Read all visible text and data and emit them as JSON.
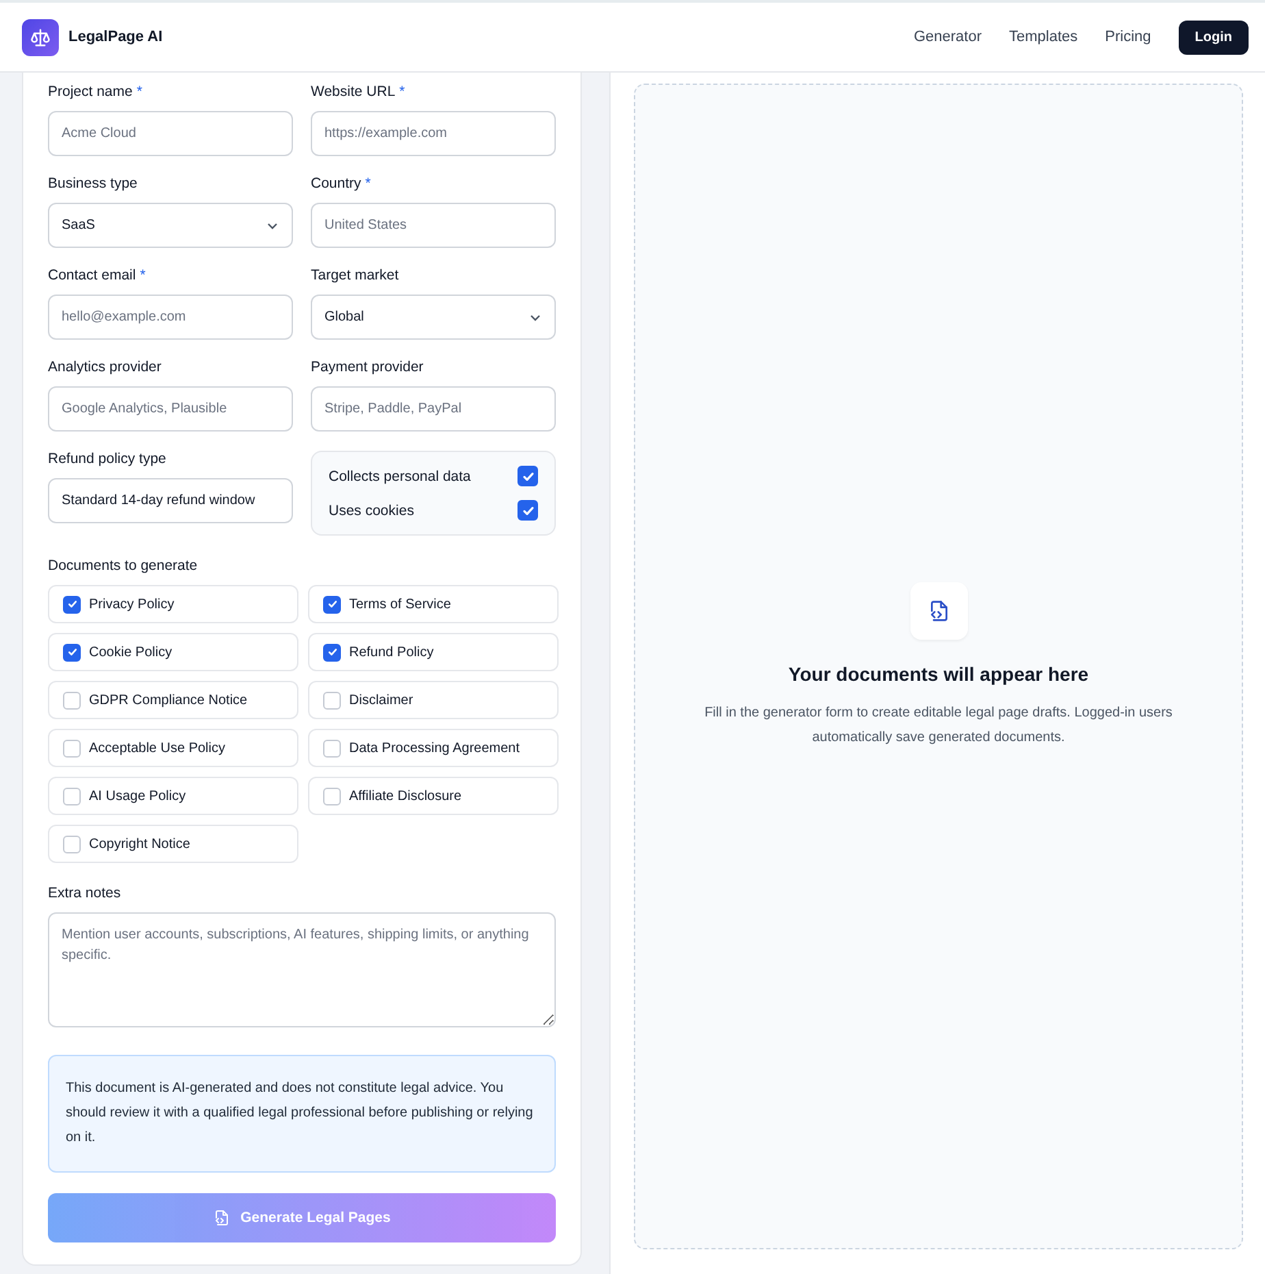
{
  "header": {
    "brand": "LegalPage AI",
    "nav": [
      {
        "label": "Generator"
      },
      {
        "label": "Templates"
      },
      {
        "label": "Pricing"
      }
    ],
    "login": "Login"
  },
  "form": {
    "fields": [
      {
        "kind": "input",
        "label": "Project name",
        "required_mark": "*",
        "placeholder": "Acme Cloud"
      },
      {
        "kind": "input",
        "label": "Website URL",
        "required_mark": "*",
        "placeholder": "https://example.com"
      },
      {
        "kind": "select",
        "label": "Business type",
        "value": "SaaS"
      },
      {
        "kind": "input",
        "label": "Country",
        "required_mark": "*",
        "placeholder": "United States"
      },
      {
        "kind": "input",
        "label": "Contact email",
        "required_mark": "*",
        "placeholder": "hello@example.com"
      },
      {
        "kind": "select",
        "label": "Target market",
        "value": "Global"
      },
      {
        "kind": "input",
        "label": "Analytics provider",
        "placeholder": "Google Analytics, Plausible"
      },
      {
        "kind": "input",
        "label": "Payment provider",
        "placeholder": "Stripe, Paddle, PayPal"
      },
      {
        "kind": "input",
        "label": "Refund policy type",
        "value": "Standard 14-day refund window"
      },
      {
        "kind": "toggles",
        "items": [
          {
            "label": "Collects personal data",
            "checked": true
          },
          {
            "label": "Uses cookies",
            "checked": true
          }
        ]
      }
    ],
    "documents": {
      "label": "Documents to generate",
      "items": [
        {
          "label": "Privacy Policy",
          "checked": true
        },
        {
          "label": "Terms of Service",
          "checked": true
        },
        {
          "label": "Cookie Policy",
          "checked": true
        },
        {
          "label": "Refund Policy",
          "checked": true
        },
        {
          "label": "GDPR Compliance Notice",
          "checked": false
        },
        {
          "label": "Disclaimer",
          "checked": false
        },
        {
          "label": "Acceptable Use Policy",
          "checked": false
        },
        {
          "label": "Data Processing Agreement",
          "checked": false
        },
        {
          "label": "AI Usage Policy",
          "checked": false
        },
        {
          "label": "Affiliate Disclosure",
          "checked": false
        },
        {
          "label": "Copyright Notice",
          "checked": false
        }
      ]
    },
    "notes": {
      "label": "Extra notes",
      "placeholder": "Mention user accounts, subscriptions, AI features, shipping limits, or anything specific."
    },
    "disclaimer": "This document is AI-generated and does not constitute legal advice. You should review it with a qualified legal professional before publishing or relying on it.",
    "generate": {
      "label": "Generate Legal Pages",
      "disabled": true
    }
  },
  "preview": {
    "title": "Your documents will appear here",
    "text": "Fill in the generator form to create editable legal page drafts. Logged-in users automatically save generated documents."
  }
}
